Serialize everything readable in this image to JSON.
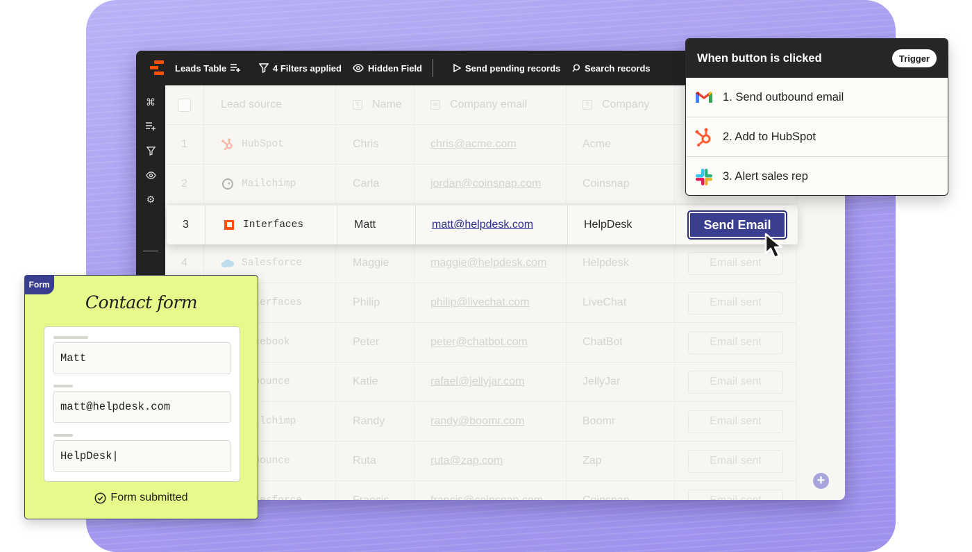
{
  "toolbar": {
    "table_name": "Leads Table",
    "filters": "4 Filters applied",
    "hidden_field": "Hidden Field",
    "send_pending": "Send pending records",
    "search": "Search records"
  },
  "table": {
    "headers": {
      "lead_source": "Lead source",
      "name": "Name",
      "company_email": "Company email",
      "company": "Company"
    },
    "rows": [
      {
        "num": "1",
        "source": "HubSpot",
        "name": "Chris",
        "email": "chris@acme.com",
        "company": "Acme",
        "action": ""
      },
      {
        "num": "2",
        "source": "Mailchimp",
        "name": "Carla",
        "email": "jordan@coinsnap.com",
        "company": "Coinsnap",
        "action": ""
      },
      {
        "num": "3",
        "source": "Interfaces",
        "name": "Matt",
        "email": "matt@helpdesk.com",
        "company": "HelpDesk",
        "action": "Send Email"
      },
      {
        "num": "4",
        "source": "Salesforce",
        "name": "Maggie",
        "email": "maggie@helpdesk.com",
        "company": "Helpdesk",
        "action": "Email sent"
      },
      {
        "num": "",
        "source": "Interfaces",
        "name": "Philip",
        "email": "philip@livechat.com",
        "company": "LiveChat",
        "action": "Email sent"
      },
      {
        "num": "",
        "source": "Facebook",
        "name": "Peter",
        "email": "peter@chatbot.com",
        "company": "ChatBot",
        "action": "Email sent"
      },
      {
        "num": "",
        "source": "Unbounce",
        "name": "Katie",
        "email": "rafael@jellyjar.com",
        "company": "JellyJar",
        "action": "Email sent"
      },
      {
        "num": "",
        "source": "Mailchimp",
        "name": "Randy",
        "email": "randy@boomr.com",
        "company": "Boomr",
        "action": "Email sent"
      },
      {
        "num": "",
        "source": "Unbounce",
        "name": "Ruta",
        "email": "ruta@zap.com",
        "company": "Zap",
        "action": "Email sent"
      },
      {
        "num": "",
        "source": "Salesforce",
        "name": "Francis",
        "email": "francis@coinsnap.com",
        "company": "Coinsnap",
        "action": "Email sent"
      }
    ]
  },
  "trigger": {
    "title": "When button is clicked",
    "badge": "Trigger",
    "steps": [
      {
        "label": "1. Send outbound email",
        "icon": "gmail-icon"
      },
      {
        "label": "2. Add to HubSpot",
        "icon": "hubspot-icon"
      },
      {
        "label": "3. Alert sales rep",
        "icon": "slack-icon"
      }
    ]
  },
  "form": {
    "tag": "Form",
    "title": "Contact form",
    "fields": [
      "Matt",
      "matt@helpdesk.com",
      "HelpDesk|"
    ],
    "status": "Form submitted"
  },
  "colors": {
    "backdrop": "#a79cf0",
    "accent": "#3a3e8f",
    "brand_orange": "#ff4f00",
    "form_bg": "#e6fa8b"
  }
}
